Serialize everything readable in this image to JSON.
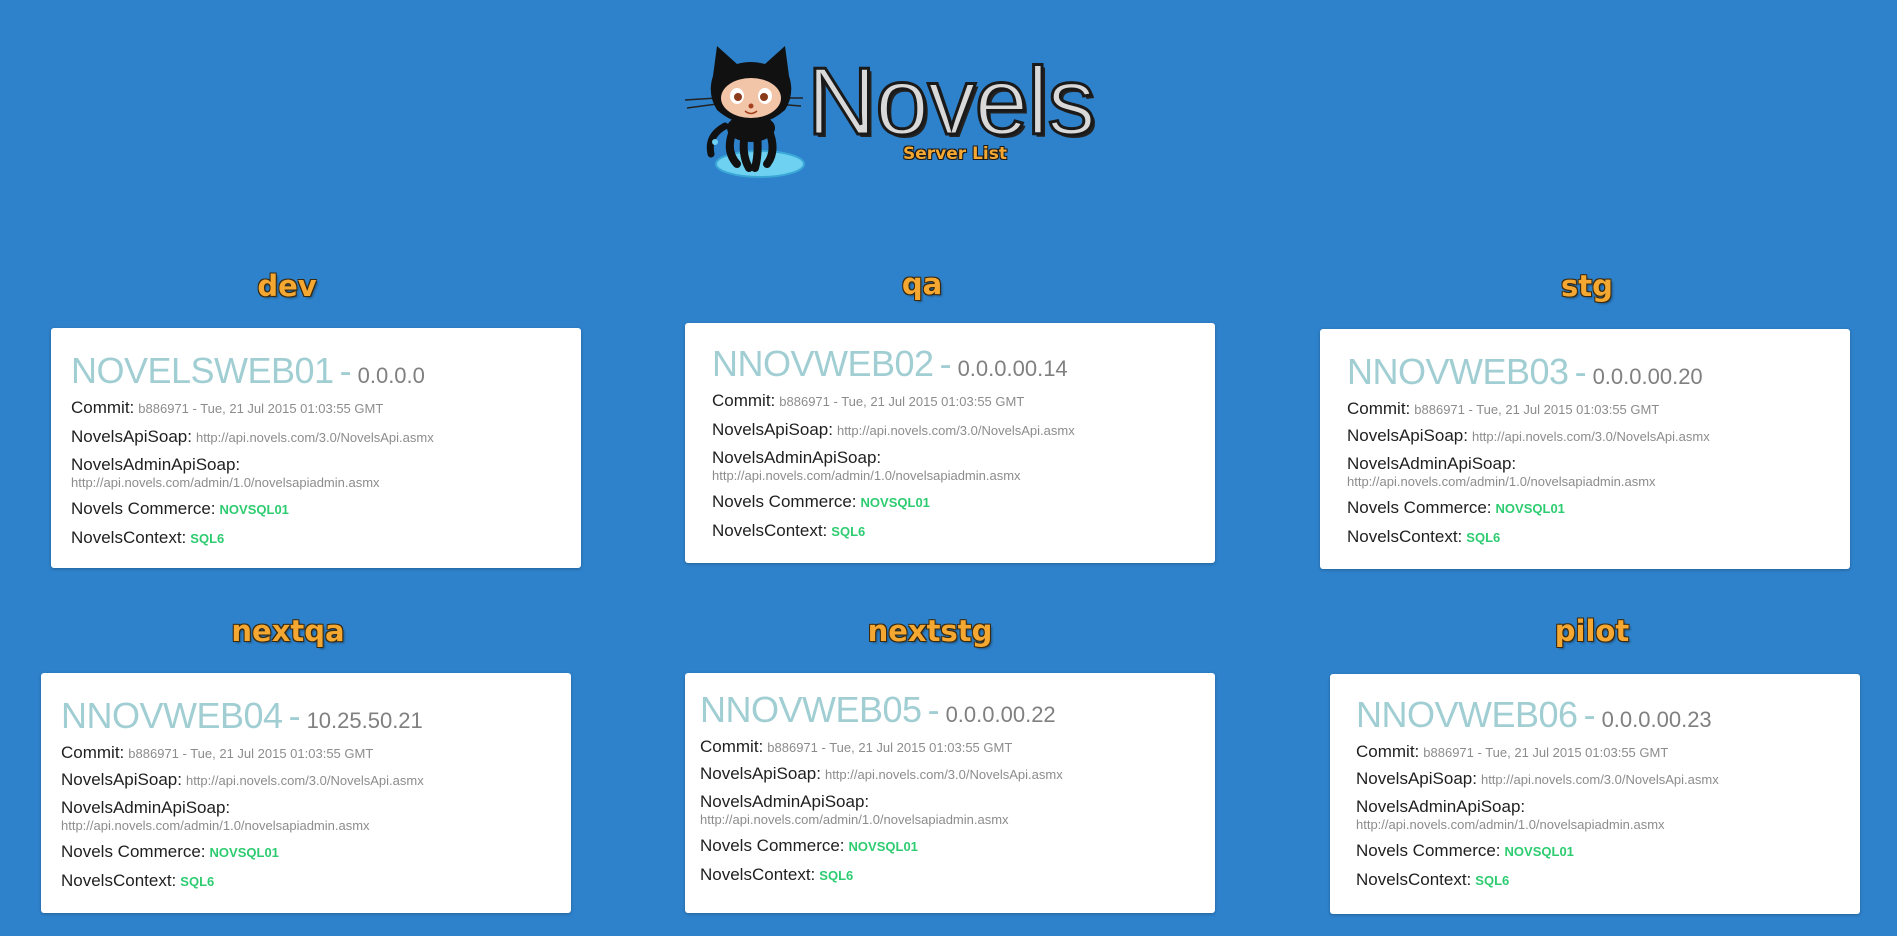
{
  "header": {
    "logo_text": "Novels",
    "subtitle": "Server List"
  },
  "labels": {
    "commit": "Commit:",
    "soap": "NovelsApiSoap:",
    "admin_soap": "NovelsAdminApiSoap:",
    "commerce": "Novels Commerce:",
    "context": "NovelsContext:",
    "separator": "-"
  },
  "colors": {
    "background": "#2e82cb",
    "env_title": "#f4a832",
    "server_name": "#a0ced3",
    "db_value": "#2ecc71"
  },
  "environments": [
    {
      "name": "dev",
      "server": "NOVELSWEB01",
      "ip": "0.0.0.0",
      "commit": "b886971 - Tue, 21 Jul 2015 01:03:55 GMT",
      "soap_url": "http://api.novels.com/3.0/NovelsApi.asmx",
      "admin_url": "http://api.novels.com/admin/1.0/novelsapiadmin.asmx",
      "commerce_db": "NOVSQL01",
      "context_db": "SQL6"
    },
    {
      "name": "qa",
      "server": "NNOVWEB02",
      "ip": "0.0.0.00.14",
      "commit": "b886971 - Tue, 21 Jul 2015 01:03:55 GMT",
      "soap_url": "http://api.novels.com/3.0/NovelsApi.asmx",
      "admin_url": "http://api.novels.com/admin/1.0/novelsapiadmin.asmx",
      "commerce_db": "NOVSQL01",
      "context_db": "SQL6"
    },
    {
      "name": "stg",
      "server": "NNOVWEB03",
      "ip": "0.0.0.00.20",
      "commit": "b886971 - Tue, 21 Jul 2015 01:03:55 GMT",
      "soap_url": "http://api.novels.com/3.0/NovelsApi.asmx",
      "admin_url": "http://api.novels.com/admin/1.0/novelsapiadmin.asmx",
      "commerce_db": "NOVSQL01",
      "context_db": "SQL6"
    },
    {
      "name": "nextqa",
      "server": "NNOVWEB04",
      "ip": "10.25.50.21",
      "commit": "b886971 - Tue, 21 Jul 2015 01:03:55 GMT",
      "soap_url": "http://api.novels.com/3.0/NovelsApi.asmx",
      "admin_url": "http://api.novels.com/admin/1.0/novelsapiadmin.asmx",
      "commerce_db": "NOVSQL01",
      "context_db": "SQL6"
    },
    {
      "name": "nextstg",
      "server": "NNOVWEB05",
      "ip": "0.0.0.00.22",
      "commit": "b886971 - Tue, 21 Jul 2015 01:03:55 GMT",
      "soap_url": "http://api.novels.com/3.0/NovelsApi.asmx",
      "admin_url": "http://api.novels.com/admin/1.0/novelsapiadmin.asmx",
      "commerce_db": "NOVSQL01",
      "context_db": "SQL6"
    },
    {
      "name": "pilot",
      "server": "NNOVWEB06",
      "ip": "0.0.0.00.23",
      "commit": "b886971 - Tue, 21 Jul 2015 01:03:55 GMT",
      "soap_url": "http://api.novels.com/3.0/NovelsApi.asmx",
      "admin_url": "http://api.novels.com/admin/1.0/novelsapiadmin.asmx",
      "commerce_db": "NOVSQL01",
      "context_db": "SQL6"
    }
  ]
}
